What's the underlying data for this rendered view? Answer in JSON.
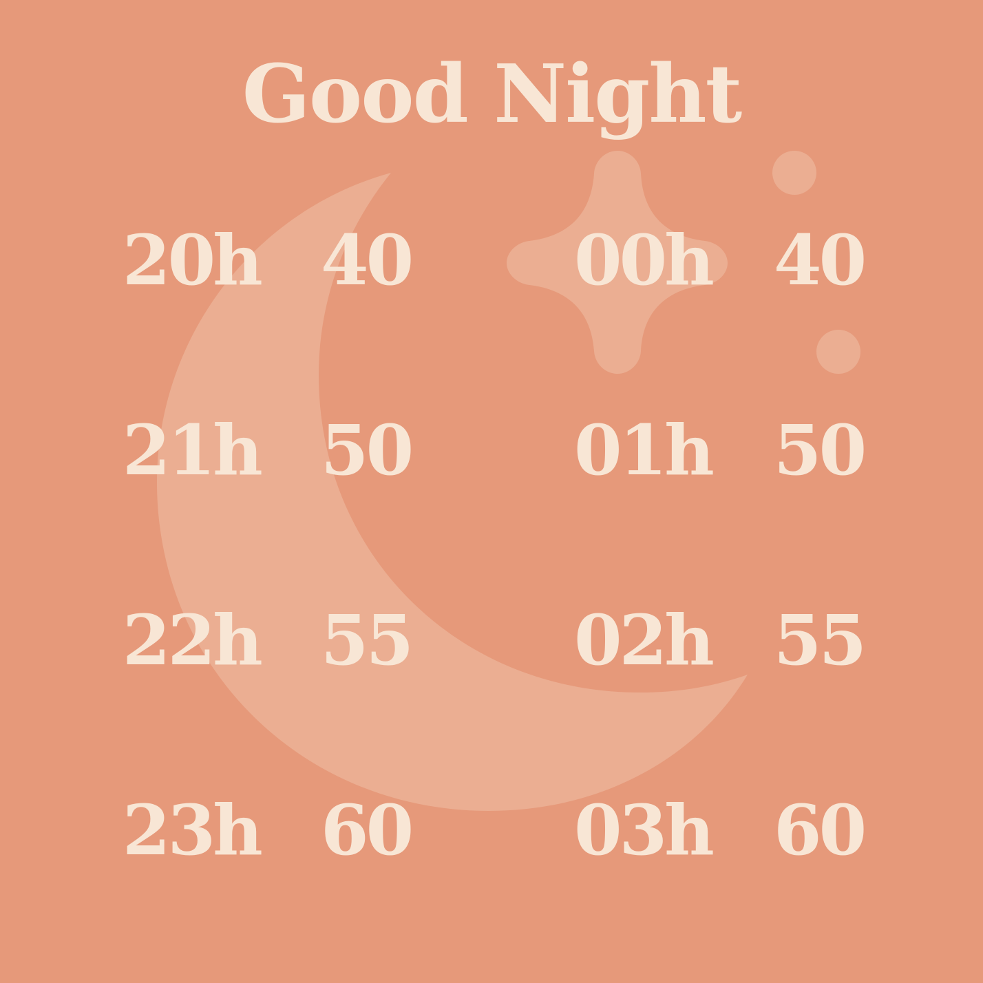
{
  "title": "Good Night",
  "schedule": [
    {
      "hour": "20h",
      "value": "40"
    },
    {
      "hour": "21h",
      "value": "50"
    },
    {
      "hour": "22h",
      "value": "55"
    },
    {
      "hour": "23h",
      "value": "60"
    },
    {
      "hour": "00h",
      "value": "40"
    },
    {
      "hour": "01h",
      "value": "50"
    },
    {
      "hour": "02h",
      "value": "55"
    },
    {
      "hour": "03h",
      "value": "60"
    }
  ],
  "colors": {
    "background": "#e6997a",
    "text": "#f8e6d5",
    "decoration": "#ebae92"
  },
  "icons": [
    "crescent-moon-icon",
    "sparkle-star-icon",
    "dot-icon"
  ]
}
